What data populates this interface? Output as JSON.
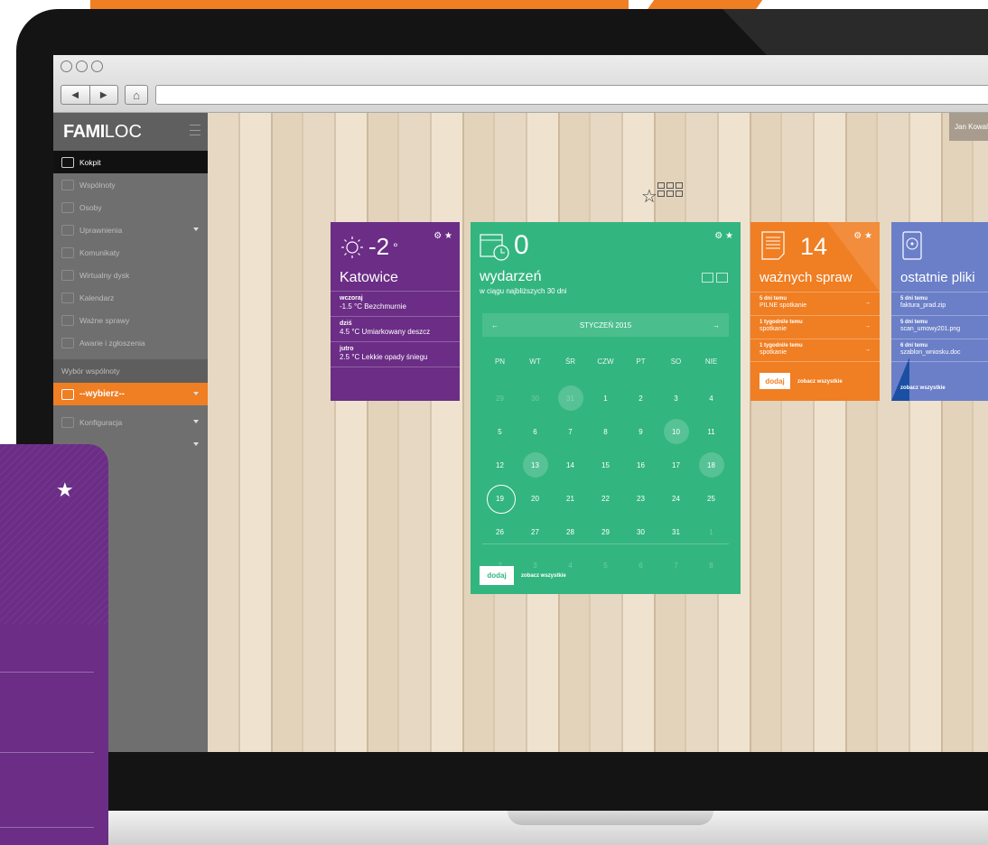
{
  "browser": {
    "back": "◀",
    "forward": "▶"
  },
  "app": {
    "logo_bold": "FAMI",
    "logo_light": "LOC",
    "user": "Jan Kowalski"
  },
  "sidebar": {
    "items": [
      {
        "label": "Kokpit"
      },
      {
        "label": "Wspólnoty"
      },
      {
        "label": "Osoby"
      },
      {
        "label": "Uprawnienia"
      },
      {
        "label": "Komunikaty"
      },
      {
        "label": "Wirtualny dysk"
      },
      {
        "label": "Kalendarz"
      },
      {
        "label": "Ważne sprawy"
      },
      {
        "label": "Awarie i zgłoszenia"
      }
    ],
    "section": "Wybór wspólnoty",
    "select": "--wybierz--",
    "config": "Konfiguracja"
  },
  "weather": {
    "temp": "-2",
    "deg": "°",
    "city": "Katowice",
    "rows": [
      {
        "day": "wczoraj",
        "desc": "-1.5 °C Bezchmurnie"
      },
      {
        "day": "dziś",
        "desc": "4.5 °C Umiarkowany deszcz"
      },
      {
        "day": "jutro",
        "desc": "2.5 °C Lekkie opady śniegu"
      }
    ]
  },
  "events": {
    "count": "0",
    "title": "wydarzeń",
    "subtitle": "w ciągu najbliższych 30 dni",
    "month": "STYCZEŃ 2015",
    "prev": "←",
    "next": "→",
    "weekdays": [
      "PN",
      "WT",
      "ŚR",
      "CZW",
      "PT",
      "SO",
      "NIE"
    ],
    "days": [
      "29",
      "30",
      "31",
      "1",
      "2",
      "3",
      "4",
      "5",
      "6",
      "7",
      "8",
      "9",
      "10",
      "11",
      "12",
      "13",
      "14",
      "15",
      "16",
      "17",
      "18",
      "19",
      "20",
      "21",
      "22",
      "23",
      "24",
      "25",
      "26",
      "27",
      "28",
      "29",
      "30",
      "31",
      "1",
      "2",
      "3",
      "4",
      "5",
      "6",
      "7",
      "8"
    ],
    "add": "dodaj",
    "see_all": "zobacz wszystkie"
  },
  "tasks": {
    "count": "14",
    "title": "ważnych spraw",
    "rows": [
      {
        "when": "5 dni temu",
        "what": "PILNE spotkanie"
      },
      {
        "when": "1 tygodni/e temu",
        "what": "spotkanie"
      },
      {
        "when": "1 tygodni/e temu",
        "what": "spotkanie"
      }
    ],
    "arrow": "→",
    "add": "dodaj",
    "see_all": "zobacz wszystkie"
  },
  "files": {
    "title": "ostatnie pliki",
    "rows": [
      {
        "when": "5 dni temu",
        "what": "faktura_prad.zip"
      },
      {
        "when": "5 dni temu",
        "what": "scan_umowy201.png"
      },
      {
        "when": "6 dni temu",
        "what": "szablon_wniosku.doc"
      }
    ],
    "see_all": "zobacz wszystkie"
  },
  "colors": {
    "accent": "#f07e22",
    "purple": "#6b2d86",
    "green": "#33b57f",
    "blue": "#6b7fc8"
  }
}
